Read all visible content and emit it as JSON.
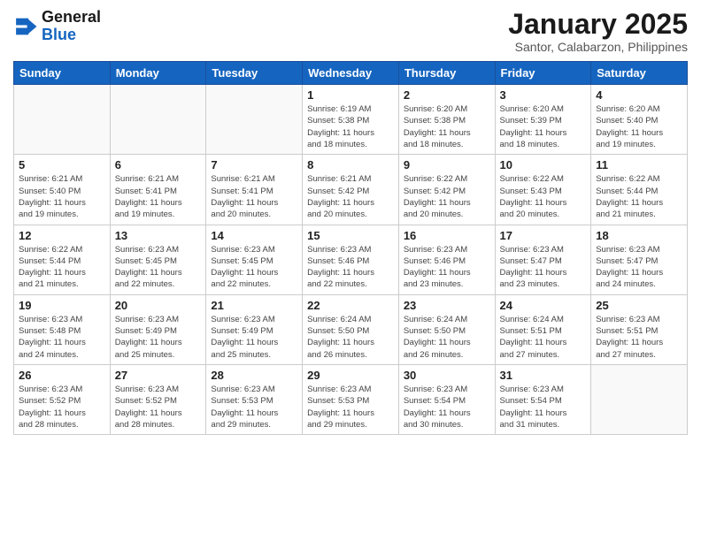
{
  "header": {
    "logo_general": "General",
    "logo_blue": "Blue",
    "title": "January 2025",
    "subtitle": "Santor, Calabarzon, Philippines"
  },
  "days_of_week": [
    "Sunday",
    "Monday",
    "Tuesday",
    "Wednesday",
    "Thursday",
    "Friday",
    "Saturday"
  ],
  "weeks": [
    [
      {
        "day": "",
        "info": ""
      },
      {
        "day": "",
        "info": ""
      },
      {
        "day": "",
        "info": ""
      },
      {
        "day": "1",
        "info": "Sunrise: 6:19 AM\nSunset: 5:38 PM\nDaylight: 11 hours\nand 18 minutes."
      },
      {
        "day": "2",
        "info": "Sunrise: 6:20 AM\nSunset: 5:38 PM\nDaylight: 11 hours\nand 18 minutes."
      },
      {
        "day": "3",
        "info": "Sunrise: 6:20 AM\nSunset: 5:39 PM\nDaylight: 11 hours\nand 18 minutes."
      },
      {
        "day": "4",
        "info": "Sunrise: 6:20 AM\nSunset: 5:40 PM\nDaylight: 11 hours\nand 19 minutes."
      }
    ],
    [
      {
        "day": "5",
        "info": "Sunrise: 6:21 AM\nSunset: 5:40 PM\nDaylight: 11 hours\nand 19 minutes."
      },
      {
        "day": "6",
        "info": "Sunrise: 6:21 AM\nSunset: 5:41 PM\nDaylight: 11 hours\nand 19 minutes."
      },
      {
        "day": "7",
        "info": "Sunrise: 6:21 AM\nSunset: 5:41 PM\nDaylight: 11 hours\nand 20 minutes."
      },
      {
        "day": "8",
        "info": "Sunrise: 6:21 AM\nSunset: 5:42 PM\nDaylight: 11 hours\nand 20 minutes."
      },
      {
        "day": "9",
        "info": "Sunrise: 6:22 AM\nSunset: 5:42 PM\nDaylight: 11 hours\nand 20 minutes."
      },
      {
        "day": "10",
        "info": "Sunrise: 6:22 AM\nSunset: 5:43 PM\nDaylight: 11 hours\nand 20 minutes."
      },
      {
        "day": "11",
        "info": "Sunrise: 6:22 AM\nSunset: 5:44 PM\nDaylight: 11 hours\nand 21 minutes."
      }
    ],
    [
      {
        "day": "12",
        "info": "Sunrise: 6:22 AM\nSunset: 5:44 PM\nDaylight: 11 hours\nand 21 minutes."
      },
      {
        "day": "13",
        "info": "Sunrise: 6:23 AM\nSunset: 5:45 PM\nDaylight: 11 hours\nand 22 minutes."
      },
      {
        "day": "14",
        "info": "Sunrise: 6:23 AM\nSunset: 5:45 PM\nDaylight: 11 hours\nand 22 minutes."
      },
      {
        "day": "15",
        "info": "Sunrise: 6:23 AM\nSunset: 5:46 PM\nDaylight: 11 hours\nand 22 minutes."
      },
      {
        "day": "16",
        "info": "Sunrise: 6:23 AM\nSunset: 5:46 PM\nDaylight: 11 hours\nand 23 minutes."
      },
      {
        "day": "17",
        "info": "Sunrise: 6:23 AM\nSunset: 5:47 PM\nDaylight: 11 hours\nand 23 minutes."
      },
      {
        "day": "18",
        "info": "Sunrise: 6:23 AM\nSunset: 5:47 PM\nDaylight: 11 hours\nand 24 minutes."
      }
    ],
    [
      {
        "day": "19",
        "info": "Sunrise: 6:23 AM\nSunset: 5:48 PM\nDaylight: 11 hours\nand 24 minutes."
      },
      {
        "day": "20",
        "info": "Sunrise: 6:23 AM\nSunset: 5:49 PM\nDaylight: 11 hours\nand 25 minutes."
      },
      {
        "day": "21",
        "info": "Sunrise: 6:23 AM\nSunset: 5:49 PM\nDaylight: 11 hours\nand 25 minutes."
      },
      {
        "day": "22",
        "info": "Sunrise: 6:24 AM\nSunset: 5:50 PM\nDaylight: 11 hours\nand 26 minutes."
      },
      {
        "day": "23",
        "info": "Sunrise: 6:24 AM\nSunset: 5:50 PM\nDaylight: 11 hours\nand 26 minutes."
      },
      {
        "day": "24",
        "info": "Sunrise: 6:24 AM\nSunset: 5:51 PM\nDaylight: 11 hours\nand 27 minutes."
      },
      {
        "day": "25",
        "info": "Sunrise: 6:23 AM\nSunset: 5:51 PM\nDaylight: 11 hours\nand 27 minutes."
      }
    ],
    [
      {
        "day": "26",
        "info": "Sunrise: 6:23 AM\nSunset: 5:52 PM\nDaylight: 11 hours\nand 28 minutes."
      },
      {
        "day": "27",
        "info": "Sunrise: 6:23 AM\nSunset: 5:52 PM\nDaylight: 11 hours\nand 28 minutes."
      },
      {
        "day": "28",
        "info": "Sunrise: 6:23 AM\nSunset: 5:53 PM\nDaylight: 11 hours\nand 29 minutes."
      },
      {
        "day": "29",
        "info": "Sunrise: 6:23 AM\nSunset: 5:53 PM\nDaylight: 11 hours\nand 29 minutes."
      },
      {
        "day": "30",
        "info": "Sunrise: 6:23 AM\nSunset: 5:54 PM\nDaylight: 11 hours\nand 30 minutes."
      },
      {
        "day": "31",
        "info": "Sunrise: 6:23 AM\nSunset: 5:54 PM\nDaylight: 11 hours\nand 31 minutes."
      },
      {
        "day": "",
        "info": ""
      }
    ]
  ]
}
